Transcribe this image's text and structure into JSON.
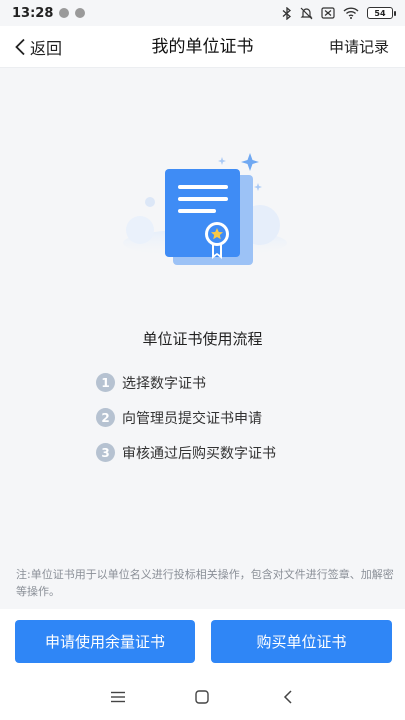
{
  "status_bar": {
    "time": "13:28",
    "battery": "54"
  },
  "header": {
    "back_label": "返回",
    "title": "我的单位证书",
    "action_label": "申请记录"
  },
  "process": {
    "title": "单位证书使用流程",
    "steps": [
      {
        "num": "1",
        "text": "选择数字证书"
      },
      {
        "num": "2",
        "text": "向管理员提交证书申请"
      },
      {
        "num": "3",
        "text": "审核通过后购买数字证书"
      }
    ]
  },
  "note": "注:单位证书用于以单位名义进行投标相关操作，包含对文件进行签章、加解密等操作。",
  "buttons": {
    "apply_label": "申请使用余量证书",
    "buy_label": "购买单位证书"
  },
  "colors": {
    "accent": "#2f86f6",
    "step_badge": "#b6c2d1",
    "note_text": "#8a8f97"
  }
}
